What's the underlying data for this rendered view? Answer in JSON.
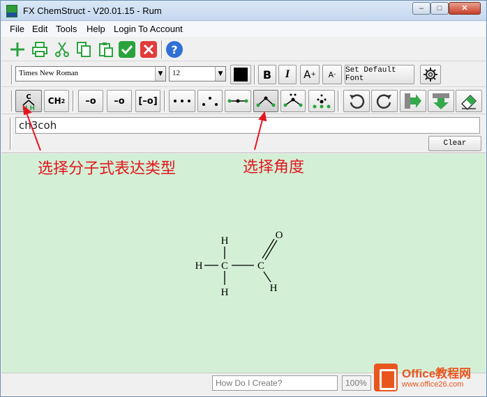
{
  "window": {
    "title": "FX ChemStruct - V20.01.15 - Rum",
    "controls": {
      "minimize": "–",
      "maximize": "□",
      "close": "✕"
    }
  },
  "menu": [
    "File",
    "Edit",
    "Tools",
    "Help",
    "Login To Account"
  ],
  "toolbar1": {
    "icons": [
      "add-icon",
      "print-icon",
      "cut-icon",
      "copy-icon",
      "paste-icon",
      "check-icon",
      "cancel-icon",
      "help-icon"
    ]
  },
  "font_toolbar": {
    "font_family": "Times New Roman",
    "font_size": "12",
    "bold": "B",
    "italic": "I",
    "superscript": "A",
    "subscript": "A",
    "set_default_font": "Set Default Font"
  },
  "structure_toolbar": {
    "mode_expanded": {
      "top": "C",
      "bottom": "H H"
    },
    "mode_condensed": {
      "main": "CH",
      "sub": "2"
    },
    "bond_single_o": "–o",
    "bond_minus_o": "–o",
    "bracket_o": "[–o]"
  },
  "input": {
    "formula": "ch3coh",
    "clear_label": "Clear"
  },
  "molecule": {
    "atoms": [
      "H",
      "H",
      "H",
      "C",
      "C",
      "O",
      "H"
    ]
  },
  "status": {
    "how_do_i_create": "How Do I Create?",
    "zoom": "100%"
  },
  "annotations": {
    "select_formula_type": "选择分子式表达类型",
    "select_angle": "选择角度"
  },
  "watermark": {
    "title": "Office教程网",
    "url": "www.office26.com"
  },
  "colors": {
    "canvas_bg": "#d3f0d6",
    "annotation_red": "#e4161f",
    "check_green": "#2aa33d",
    "cancel_red": "#e23b3b",
    "help_blue": "#2f6fd6",
    "arrow_green": "#34a84a"
  }
}
